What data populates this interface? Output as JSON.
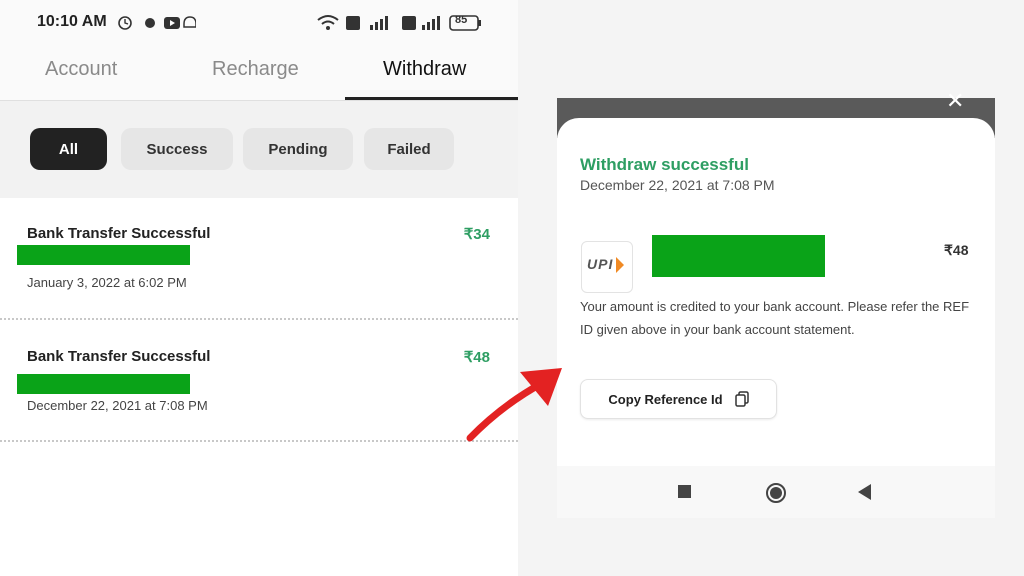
{
  "status_bar": {
    "time": "10:10 AM",
    "battery": "85"
  },
  "tabs": [
    {
      "label": "Account",
      "active": false
    },
    {
      "label": "Recharge",
      "active": false
    },
    {
      "label": "Withdraw",
      "active": true
    }
  ],
  "filters": [
    {
      "label": "All",
      "selected": true
    },
    {
      "label": "Success",
      "selected": false
    },
    {
      "label": "Pending",
      "selected": false
    },
    {
      "label": "Failed",
      "selected": false
    }
  ],
  "transactions": [
    {
      "title": "Bank Transfer Successful",
      "amount": "₹34",
      "date": "January 3, 2022 at 6:02 PM"
    },
    {
      "title": "Bank Transfer Successful",
      "amount": "₹48",
      "date": "December 22, 2021 at 7:08 PM"
    }
  ],
  "dialog": {
    "title": "Withdraw successful",
    "date": "December 22, 2021 at 7:08 PM",
    "logo_text": "UPI",
    "amount": "₹48",
    "message": "Your amount is credited to your bank account. Please refer the REF ID given above in your bank account statement.",
    "copy_button": "Copy Reference Id"
  },
  "colors": {
    "success_green": "#2e9e63",
    "redaction_green": "#0aa318",
    "arrow_red": "#e32222"
  }
}
